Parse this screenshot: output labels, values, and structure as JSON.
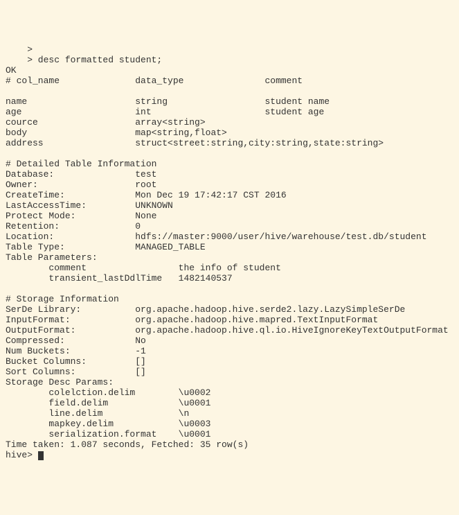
{
  "lines": {
    "l0": "    >",
    "l1": "    > desc formatted student;",
    "l2": "OK",
    "l3": "# col_name              data_type               comment",
    "l4": "",
    "l5": "name                    string                  student name",
    "l6": "age                     int                     student age",
    "l7": "cource                  array<string>",
    "l8": "body                    map<string,float>",
    "l9": "address                 struct<street:string,city:string,state:string>",
    "l10": "",
    "l11": "# Detailed Table Information",
    "l12": "Database:               test",
    "l13": "Owner:                  root",
    "l14": "CreateTime:             Mon Dec 19 17:42:17 CST 2016",
    "l15": "LastAccessTime:         UNKNOWN",
    "l16": "Protect Mode:           None",
    "l17": "Retention:              0",
    "l18": "Location:               hdfs://master:9000/user/hive/warehouse/test.db/student",
    "l19": "Table Type:             MANAGED_TABLE",
    "l20": "Table Parameters:",
    "l21": "        comment                 the info of student",
    "l22": "        transient_lastDdlTime   1482140537",
    "l23": "",
    "l24": "# Storage Information",
    "l25": "SerDe Library:          org.apache.hadoop.hive.serde2.lazy.LazySimpleSerDe",
    "l26": "InputFormat:            org.apache.hadoop.hive.mapred.TextInputFormat",
    "l27": "OutputFormat:           org.apache.hadoop.hive.ql.io.HiveIgnoreKeyTextOutputFormat",
    "l28": "Compressed:             No",
    "l29": "Num Buckets:            -1",
    "l30": "Bucket Columns:         []",
    "l31": "Sort Columns:           []",
    "l32": "Storage Desc Params:",
    "l33": "        colelction.delim        \\u0002",
    "l34": "        field.delim             \\u0001",
    "l35": "        line.delim              \\n",
    "l36": "        mapkey.delim            \\u0003",
    "l37": "        serialization.format    \\u0001",
    "l38": "Time taken: 1.087 seconds, Fetched: 35 row(s)",
    "l39": "hive> "
  }
}
